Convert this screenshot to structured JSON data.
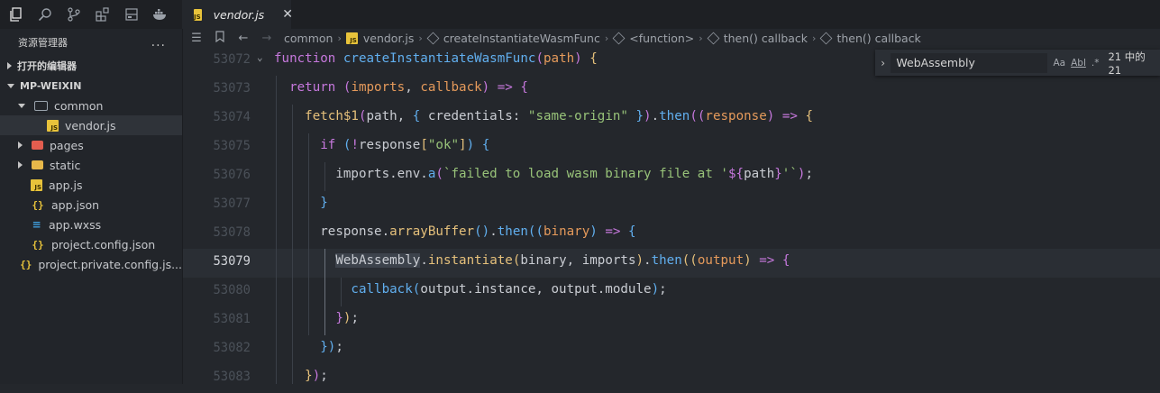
{
  "activity_bar": [
    "explorer-icon",
    "search-icon",
    "source-control-icon",
    "extensions-icon",
    "layout-icon",
    "docker-icon"
  ],
  "sidebar": {
    "title": "资源管理器",
    "more": "...",
    "open_editors": "打开的编辑器",
    "project": "MP-WEIXIN",
    "tree": [
      {
        "label": "common",
        "type": "folder-open",
        "indent": 20,
        "arrow": "down"
      },
      {
        "label": "vendor.js",
        "type": "js",
        "indent": 38,
        "arrow": "none",
        "selected": true
      },
      {
        "label": "pages",
        "type": "folder-red",
        "indent": 20,
        "arrow": "right"
      },
      {
        "label": "static",
        "type": "folder",
        "indent": 20,
        "arrow": "right"
      },
      {
        "label": "app.js",
        "type": "js",
        "indent": 20,
        "arrow": "none"
      },
      {
        "label": "app.json",
        "type": "json",
        "indent": 20,
        "arrow": "none"
      },
      {
        "label": "app.wxss",
        "type": "css",
        "indent": 20,
        "arrow": "none"
      },
      {
        "label": "project.config.json",
        "type": "json",
        "indent": 20,
        "arrow": "none"
      },
      {
        "label": "project.private.config.js...",
        "type": "json",
        "indent": 20,
        "arrow": "none"
      }
    ]
  },
  "tab": {
    "label": "vendor.js",
    "close": "✕"
  },
  "breadcrumb": {
    "items": [
      "common",
      "vendor.js",
      "createInstantiateWasmFunc",
      "<function>",
      "then() callback",
      "then() callback"
    ]
  },
  "find": {
    "query": "WebAssembly",
    "opt_case": "Aa",
    "opt_word": "Abl",
    "opt_regex": ".*",
    "count": "21 中的 21"
  },
  "editor": {
    "current_line": "53079",
    "lines": [
      {
        "n": "53072",
        "html": "<span class='kw'>function</span> <span class='fnc'>createInstantiateWasmFunc</span><span class='brk'>(</span><span class='par'>path</span><span class='brk'>)</span> <span class='fn'>{</span>"
      },
      {
        "n": "53073",
        "html": "  <span class='kw'>return</span> <span class='brk'>(</span><span class='par'>imports</span>, <span class='par'>callback</span><span class='brk'>)</span> <span class='op'>=></span> <span class='brk'>{</span>"
      },
      {
        "n": "53074",
        "html": "    <span class='fn'>fetch$1</span><span class='brk'>(</span>path, <span class='fnc'>{</span> credentials: <span class='str'>\"same-origin\"</span> <span class='fnc'>}</span><span class='brk'>)</span>.<span class='fnc'>then</span><span class='brk'>((</span><span class='par'>response</span><span class='brk'>)</span> <span class='op'>=></span> <span class='fn'>{</span>"
      },
      {
        "n": "53075",
        "html": "      <span class='kw'>if</span> <span class='fnc'>(</span><span class='op'>!</span>response<span class='fn'>[</span><span class='str'>\"ok\"</span><span class='fn'>]</span><span class='fnc'>)</span> <span class='fnc'>{</span>"
      },
      {
        "n": "53076",
        "html": "        imports.env.<span class='fnc'>a</span><span class='brk'>(</span><span class='tpl'>`failed to load wasm binary file at '</span><span class='kw'>${</span>path<span class='kw'>}</span><span class='tpl'>'`</span><span class='brk'>)</span>;"
      },
      {
        "n": "53077",
        "html": "      <span class='fnc'>}</span>"
      },
      {
        "n": "53078",
        "html": "      response.<span class='fn'>arrayBuffer</span><span class='fnc'>()</span>.<span class='fnc'>then</span><span class='fnc'>((</span><span class='par'>binary</span><span class='fnc'>)</span> <span class='op'>=></span> <span class='fnc'>{</span>"
      },
      {
        "n": "53079",
        "html": "        <span class='hl'>WebAssembly</span>.<span class='fn'>instantiate</span><span class='fn'>(</span>binary, imports<span class='fn'>)</span>.<span class='fnc'>then</span><span class='fn'>((</span><span class='par'>output</span><span class='fn'>)</span> <span class='op'>=></span> <span class='kw'>{</span>"
      },
      {
        "n": "53080",
        "html": "          <span class='fnc'>callback</span><span class='fnc'>(</span>output.instance, output.module<span class='fnc'>)</span>;"
      },
      {
        "n": "53081",
        "html": "        <span class='kw'>}</span><span class='fn'>)</span>;"
      },
      {
        "n": "53082",
        "html": "      <span class='fnc'>}</span><span class='fnc'>)</span>;"
      },
      {
        "n": "53083",
        "html": "    <span class='fn'>}</span><span class='brk'>)</span>;"
      }
    ]
  }
}
